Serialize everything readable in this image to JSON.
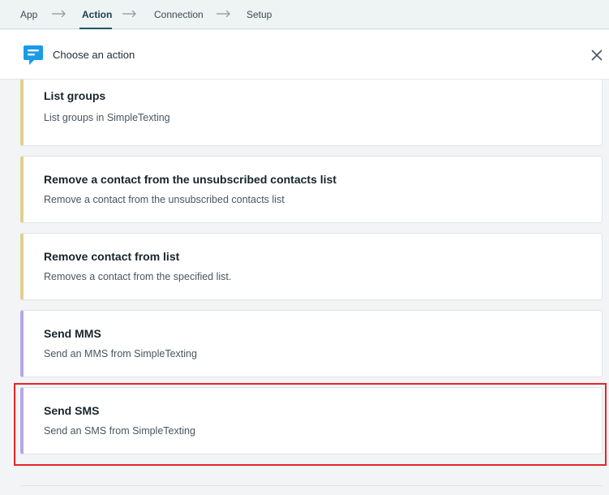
{
  "breadcrumb": {
    "steps": [
      {
        "label": "App"
      },
      {
        "label": "Action"
      },
      {
        "label": "Connection"
      },
      {
        "label": "Setup"
      }
    ],
    "active_index": 1
  },
  "header": {
    "title": "Choose an action",
    "app_icon": "simpletexting-chat-icon",
    "close_icon": "close-icon"
  },
  "actions": [
    {
      "title": "List groups",
      "description": "List groups in SimpleTexting",
      "accent": "#e2cf8f"
    },
    {
      "title": "Remove a contact from the unsubscribed contacts list",
      "description": "Remove a contact from the unsubscribed contacts list",
      "accent": "#e2cf8f"
    },
    {
      "title": "Remove contact from list",
      "description": "Removes a contact from the specified list.",
      "accent": "#e2cf8f"
    },
    {
      "title": "Send MMS",
      "description": "Send an MMS from SimpleTexting",
      "accent": "#b7a7e6"
    },
    {
      "title": "Send SMS",
      "description": "Send an SMS from SimpleTexting",
      "accent": "#b7a7e6"
    }
  ],
  "colors": {
    "brand_blue": "#1a9be6",
    "highlight_red": "#e5252a"
  }
}
